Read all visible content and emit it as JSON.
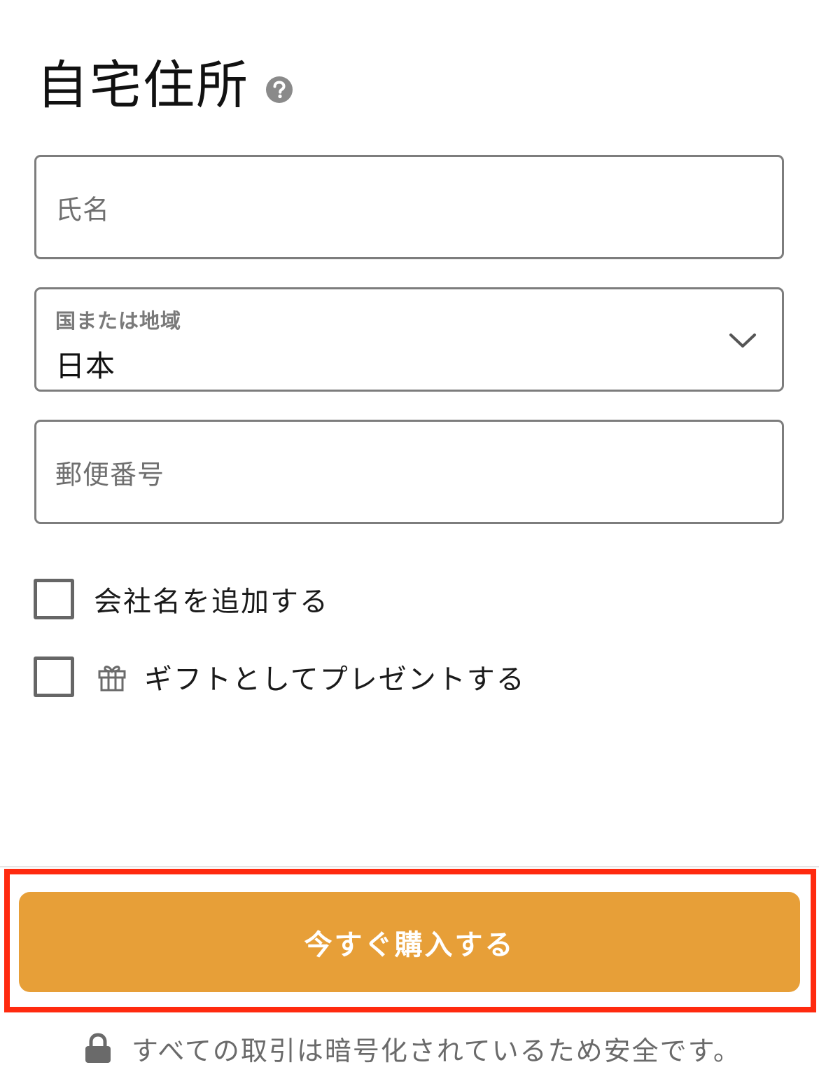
{
  "header": {
    "title": "自宅住所",
    "help_icon": "question-circle-icon"
  },
  "form": {
    "name_placeholder": "氏名",
    "country": {
      "label": "国または地域",
      "value": "日本",
      "icon": "chevron-down-icon"
    },
    "postal_placeholder": "郵便番号"
  },
  "options": {
    "company": {
      "label": "会社名を追加する",
      "checked": false
    },
    "gift": {
      "label": "ギフトとしてプレゼントする",
      "checked": false,
      "icon": "gift-icon"
    }
  },
  "checkout": {
    "buy_label": "今すぐ購入する",
    "secure_text": "すべての取引は暗号化されているため安全です。",
    "lock_icon": "lock-icon"
  },
  "colors": {
    "accent": "#e79f38",
    "highlight": "#ff2a0f",
    "border": "#7d7d7d"
  }
}
